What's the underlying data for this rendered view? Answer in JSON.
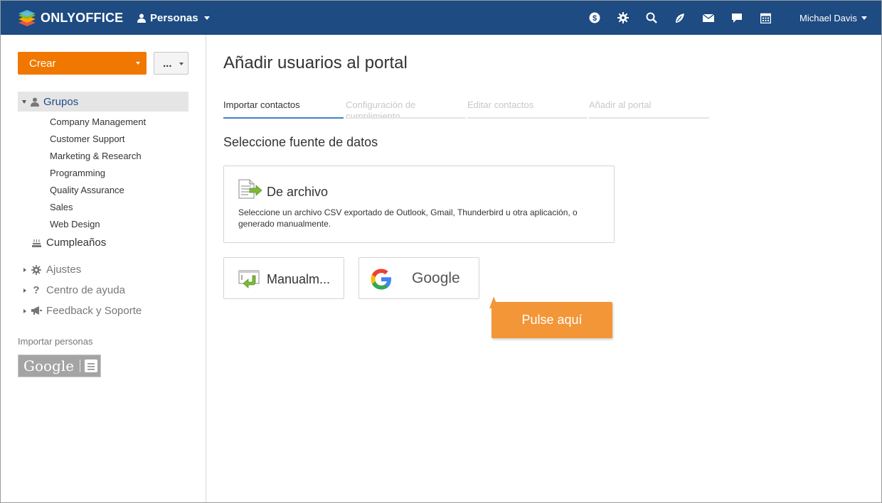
{
  "topbar": {
    "logo_text": "ONLYOFFICE",
    "module_label": "Personas",
    "user_name": "Michael Davis",
    "bg_color": "#1d4b82",
    "icons": [
      "money-icon",
      "gear-icon",
      "search-icon",
      "feed-icon",
      "mail-icon",
      "chat-icon",
      "calendar-icon"
    ]
  },
  "sidebar": {
    "create_label": "Crear",
    "more_label": "...",
    "groups_label": "Grupos",
    "groups": [
      "Company Management",
      "Customer Support",
      "Marketing & Research",
      "Programming",
      "Quality Assurance",
      "Sales",
      "Web Design"
    ],
    "birthdays_label": "Cumpleaños",
    "settings_label": "Ajustes",
    "help_label": "Centro de ayuda",
    "feedback_label": "Feedback y Soporte",
    "import_title": "Importar personas",
    "import_google_label": "Google",
    "accent_color": "#f07800"
  },
  "main": {
    "title": "Añadir usuarios al portal",
    "steps": [
      "Importar contactos",
      "Configuración de cumplimiento",
      "Editar contactos",
      "Añadir al portal"
    ],
    "active_step": 0,
    "section_title": "Seleccione fuente de datos",
    "file_card": {
      "title": "De archivo",
      "description": "Seleccione un archivo CSV exportado de Outlook, Gmail, Thunderbird u otra aplicación, o generado manualmente."
    },
    "manual_card": {
      "title": "Manualm..."
    },
    "google_card": {
      "title": "Google"
    },
    "callout_text": "Pulse aquí",
    "callout_color": "#f29637"
  }
}
